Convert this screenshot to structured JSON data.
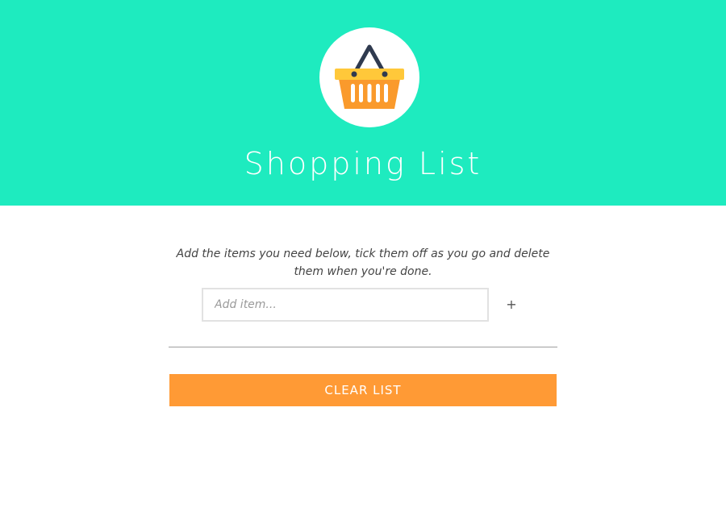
{
  "header": {
    "logo_icon": "shopping-basket-icon",
    "title": "Shopping List",
    "background_color": "#1eebbf"
  },
  "main": {
    "instructions": "Add the items you need below, tick them off as you go and delete them when you're done.",
    "add_item": {
      "placeholder": "Add item...",
      "value": "",
      "add_button_label": "+"
    },
    "items": [],
    "clear_button_label": "CLEAR LIST",
    "clear_button_color": "#ff9a35"
  }
}
